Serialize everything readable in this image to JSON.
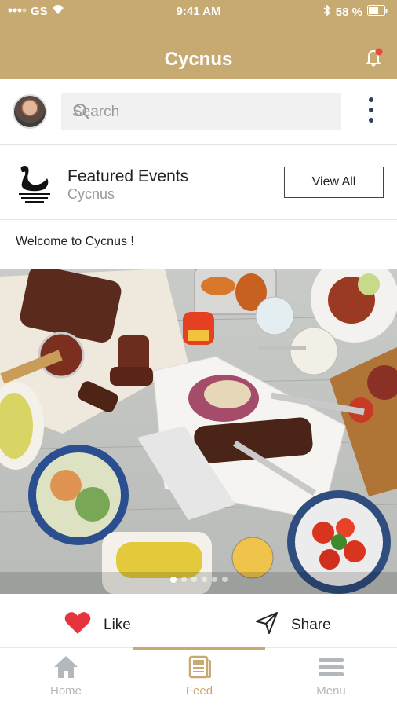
{
  "status_bar": {
    "carrier": "GS",
    "time": "9:41 AM",
    "battery": "58 %"
  },
  "header": {
    "title": "Cycnus"
  },
  "search": {
    "placeholder": "Search"
  },
  "featured": {
    "title": "Featured Events",
    "subtitle": "Cycnus",
    "view_all_label": "View All"
  },
  "post": {
    "caption": "Welcome to Cycnus !",
    "carousel_total": 6,
    "carousel_active": 1
  },
  "actions": {
    "like_label": "Like",
    "share_label": "Share"
  },
  "tabs": [
    {
      "label": "Home",
      "icon": "home-icon"
    },
    {
      "label": "Feed",
      "icon": "feed-icon"
    },
    {
      "label": "Menu",
      "icon": "menu-icon"
    }
  ],
  "colors": {
    "brand": "#c7aa72",
    "like_heart": "#e5343e",
    "kebab": "#2c3e5b"
  }
}
